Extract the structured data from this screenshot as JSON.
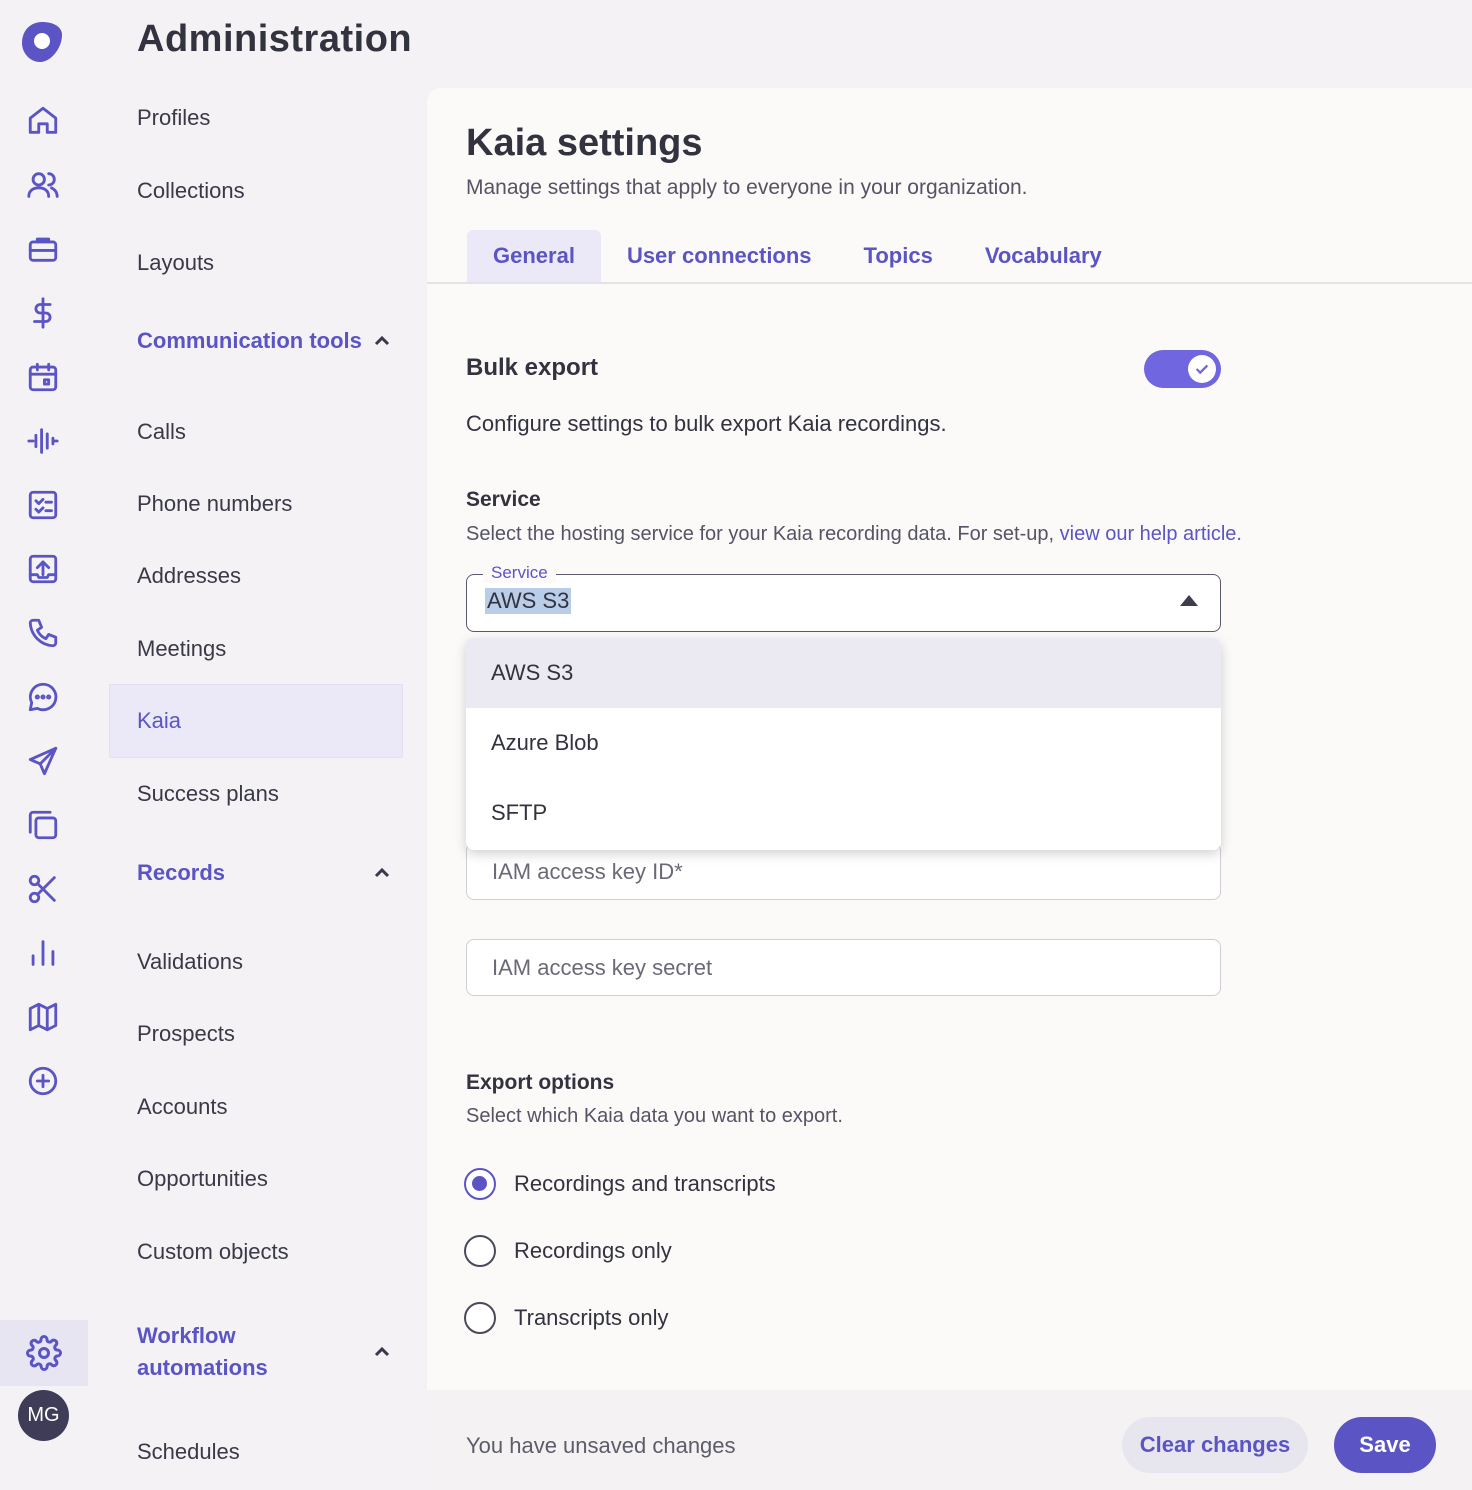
{
  "app": {
    "title": "Administration"
  },
  "rail": {
    "icons": [
      "home-icon",
      "people-icon",
      "briefcase-icon",
      "dollar-icon",
      "calendar-icon",
      "waveform-icon",
      "checklist-icon",
      "upload-icon",
      "phone-icon",
      "chat-icon",
      "send-icon",
      "copy-icon",
      "scissors-icon",
      "bar-chart-icon",
      "map-icon",
      "plus-circle-icon"
    ],
    "settings_icon": "gear-icon",
    "avatar_initials": "MG"
  },
  "nav": {
    "items_top": [
      "Profiles",
      "Collections",
      "Layouts"
    ],
    "sections": {
      "communication": {
        "label": "Communication tools",
        "items": [
          "Calls",
          "Phone numbers",
          "Addresses",
          "Meetings",
          "Kaia",
          "Success plans"
        ]
      },
      "records": {
        "label": "Records",
        "items": [
          "Validations",
          "Prospects",
          "Accounts",
          "Opportunities",
          "Custom objects"
        ]
      },
      "workflow": {
        "label_line1": "Workflow",
        "label_line2": "automations",
        "items": [
          "Schedules"
        ]
      }
    },
    "active": "Kaia"
  },
  "page": {
    "title": "Kaia settings",
    "subtitle": "Manage settings that apply to everyone in your organization.",
    "tabs": [
      "General",
      "User connections",
      "Topics",
      "Vocabulary"
    ],
    "active_tab": "General"
  },
  "bulk_export": {
    "title": "Bulk export",
    "enabled": true,
    "description": "Configure settings to bulk export Kaia recordings."
  },
  "service": {
    "label": "Service",
    "help_text": "Select the hosting service for your Kaia recording data. For set-up, ",
    "help_link": "view our help article.",
    "select_legend": "Service",
    "selected": "AWS S3",
    "options": [
      "AWS S3",
      "Azure Blob",
      "SFTP"
    ]
  },
  "fields": {
    "key_id_placeholder": "IAM access key ID*",
    "key_secret_placeholder": "IAM access key secret"
  },
  "export_options": {
    "title": "Export options",
    "help_text": "Select which Kaia data you want to export.",
    "options": [
      "Recordings and transcripts",
      "Recordings only",
      "Transcripts only"
    ],
    "selected_index": 0
  },
  "footer": {
    "message": "You have unsaved changes",
    "clear_label": "Clear changes",
    "save_label": "Save"
  },
  "colors": {
    "accent": "#5b54c4",
    "toggle": "#6f66e0"
  }
}
